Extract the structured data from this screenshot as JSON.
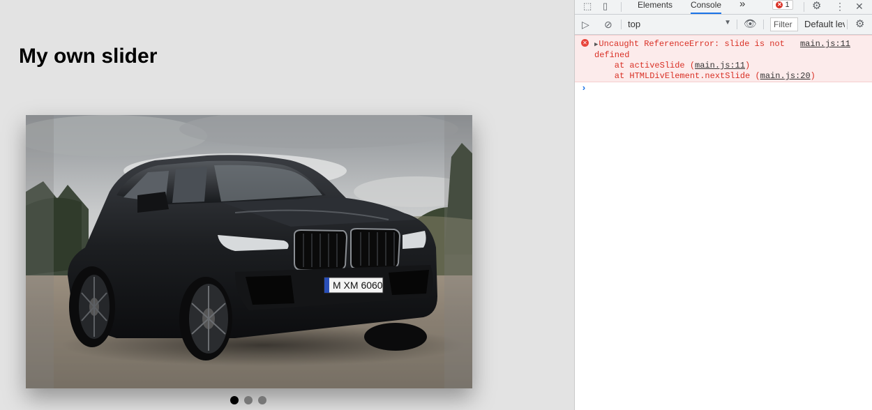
{
  "page": {
    "title": "My own slider"
  },
  "slider": {
    "dots": [
      {
        "active": true
      },
      {
        "active": false
      },
      {
        "active": false
      }
    ],
    "plate": "M XM 6060"
  },
  "devtools": {
    "tabs": {
      "elements": "Elements",
      "console": "Console",
      "more": "»"
    },
    "error_count": "1",
    "toolbar": {
      "context": "top",
      "filter_placeholder": "Filter",
      "levels": "Default levels"
    },
    "error": {
      "line1": "Uncaught ReferenceError: slide is not",
      "line2": "defined",
      "source": "main.js:11",
      "stack": [
        {
          "prefix": "    at activeSlide (",
          "link": "main.js:11",
          "suffix": ")"
        },
        {
          "prefix": "    at HTMLDivElement.nextSlide (",
          "link": "main.js:20",
          "suffix": ")"
        }
      ]
    },
    "prompt": "›"
  }
}
